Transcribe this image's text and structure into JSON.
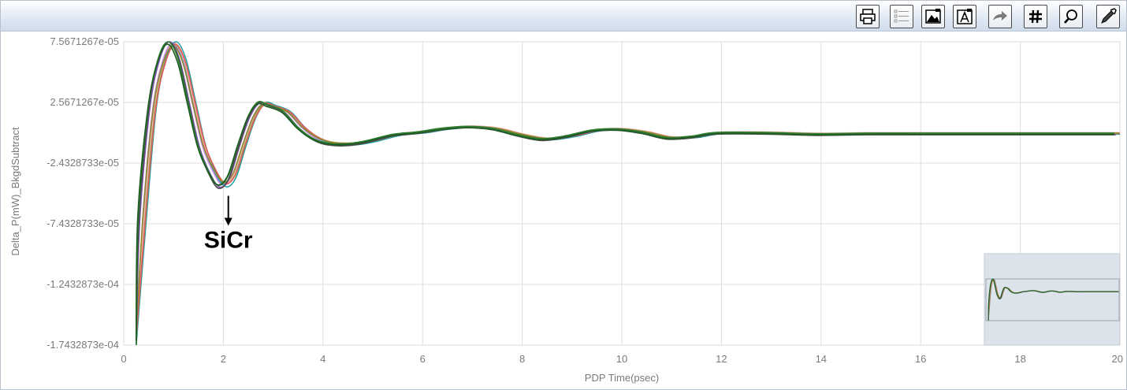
{
  "toolbar": {
    "buttons": [
      {
        "name": "print-button",
        "icon": "printer-icon"
      },
      {
        "name": "legend-button",
        "icon": "list-icon"
      },
      {
        "name": "save-image-button",
        "icon": "image-save-icon"
      },
      {
        "name": "save-text-button",
        "icon": "text-save-icon"
      },
      {
        "name": "export-button",
        "icon": "arrow-right-icon"
      },
      {
        "name": "grid-button",
        "icon": "grid-hash-icon"
      },
      {
        "name": "zoom-button",
        "icon": "magnifier-icon"
      },
      {
        "name": "edit-button",
        "icon": "pencil-icon"
      }
    ]
  },
  "chart_data": {
    "type": "line",
    "xlabel": "PDP Time(psec)",
    "ylabel": "Delta_P(mW)_BkgdSubtract",
    "xlim": [
      0,
      20
    ],
    "ylim": [
      -0.00017432873,
      7.5671267e-05
    ],
    "xticks": [
      "0",
      "2",
      "4",
      "6",
      "8",
      "10",
      "12",
      "14",
      "16",
      "18",
      "20"
    ],
    "yticks": [
      "7.5671267e-05",
      "2.5671267e-05",
      "-2.4328733e-05",
      "-7.4328733e-05",
      "-1.2432873e-04",
      "-1.7432873e-04"
    ],
    "grid": true,
    "annotation": {
      "text": "SiCr",
      "x": 2.1,
      "y": -5e-05
    },
    "base_curve": {
      "x": [
        0.25,
        0.4,
        0.6,
        0.8,
        1.0,
        1.2,
        1.4,
        1.6,
        1.8,
        2.0,
        2.2,
        2.4,
        2.6,
        2.8,
        3.0,
        3.3,
        3.6,
        3.9,
        4.2,
        4.6,
        5.0,
        5.5,
        6.0,
        6.5,
        7.0,
        7.5,
        8.0,
        8.5,
        9.0,
        9.5,
        10.0,
        10.5,
        11.0,
        11.5,
        12.0,
        13.0,
        14.0,
        15.0,
        16.0,
        17.0,
        18.0,
        19.0,
        20.0
      ],
      "y": [
        -0.000172,
        -7e-05,
        2e-05,
        6e-05,
        7.5e-05,
        6e-05,
        2.5e-05,
        -1e-05,
        -3e-05,
        -4.2e-05,
        -3.5e-05,
        -1e-05,
        1.3e-05,
        2.5e-05,
        2.3e-05,
        1.8e-05,
        5e-06,
        -4e-06,
        -8e-06,
        -8.5e-06,
        -6e-06,
        -1e-06,
        1e-06,
        4e-06,
        5.5e-06,
        4e-06,
        -1e-06,
        -4.5e-06,
        -2e-06,
        2.5e-06,
        3.5e-06,
        1e-06,
        -3.5e-06,
        -2.5e-06,
        5e-07,
        5e-07,
        -5e-07,
        0,
        0,
        0,
        0,
        0,
        0
      ]
    },
    "series": [
      {
        "color": "#2a9df4",
        "dx": 0.0,
        "yscale": 1.0,
        "dy": 0.0
      },
      {
        "color": "#ef8a3a",
        "dx": 0.02,
        "yscale": 0.98,
        "dy": 6e-07
      },
      {
        "color": "#c68be8",
        "dx": -0.02,
        "yscale": 1.0,
        "dy": -4e-07
      },
      {
        "color": "#6abf3f",
        "dx": 0.03,
        "yscale": 0.97,
        "dy": 3e-07
      },
      {
        "color": "#f4b0b0",
        "dx": 0.01,
        "yscale": 0.99,
        "dy": 8e-07
      },
      {
        "color": "#1ea4a0",
        "dx": 0.05,
        "yscale": 1.03,
        "dy": -5e-07
      },
      {
        "color": "#e65a5a",
        "dx": 0.04,
        "yscale": 0.98,
        "dy": 0.0
      },
      {
        "color": "#8a8a2a",
        "dx": -0.01,
        "yscale": 0.96,
        "dy": 4e-07
      },
      {
        "color": "#7a4fa8",
        "dx": -0.08,
        "yscale": 1.03,
        "dy": -8e-07
      },
      {
        "color": "#4a4a4a",
        "dx": -0.1,
        "yscale": 1.05,
        "dy": -1e-06
      },
      {
        "color": "#2e7d32",
        "dx": -0.11,
        "yscale": 1.02,
        "dy": 4e-07
      },
      {
        "color": "#1b5e20",
        "dx": -0.12,
        "yscale": 0.99,
        "dy": -6e-07
      }
    ]
  }
}
